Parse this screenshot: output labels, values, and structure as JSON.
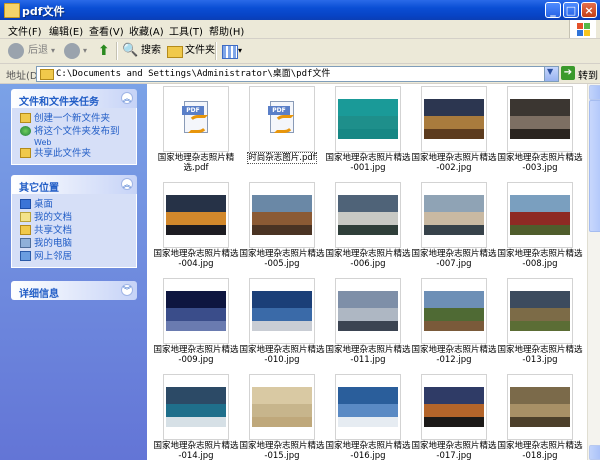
{
  "window": {
    "title": "pdf文件",
    "buttons": {
      "minimize": "_",
      "maximize": "□",
      "close": "×"
    }
  },
  "menu": [
    "文件(F)",
    "编辑(E)",
    "查看(V)",
    "收藏(A)",
    "工具(T)",
    "帮助(H)"
  ],
  "toolbar": {
    "back_label": "后退",
    "search_label": "搜索",
    "folders_label": "文件夹"
  },
  "address": {
    "label": "地址(D)",
    "path": "C:\\Documents and Settings\\Administrator\\桌面\\pdf文件",
    "go_label": "转到"
  },
  "sidebar": {
    "tasks": {
      "title": "文件和文件夹任务",
      "items": [
        "创建一个新文件夹",
        "将这个文件夹发布到",
        "Web",
        "共享此文件夹"
      ]
    },
    "places": {
      "title": "其它位置",
      "items": [
        "桌面",
        "我的文档",
        "共享文档",
        "我的电脑",
        "网上邻居"
      ]
    },
    "details": {
      "title": "详细信息"
    }
  },
  "files": [
    {
      "line1": "国家地理杂志照片精",
      "line2": "选.pdf",
      "kind": "pdf",
      "selected": false
    },
    {
      "line1": "时尚杂志图片.pdf",
      "line2": "",
      "kind": "pdf",
      "selected": true
    },
    {
      "line1": "国家地理杂志照片精选",
      "line2": "-001.jpg",
      "kind": "photo",
      "colors": [
        "#1a9a98",
        "#1e8f8b",
        "#168784"
      ]
    },
    {
      "line1": "国家地理杂志照片精选",
      "line2": "-002.jpg",
      "kind": "photo",
      "colors": [
        "#2c3650",
        "#a97b3d",
        "#5c3b1e"
      ]
    },
    {
      "line1": "国家地理杂志照片精选",
      "line2": "-003.jpg",
      "kind": "photo",
      "colors": [
        "#3b3631",
        "#7d6f63",
        "#2a241f"
      ]
    },
    {
      "line1": "国家地理杂志照片精选",
      "line2": "-004.jpg",
      "kind": "photo",
      "colors": [
        "#263247",
        "#d2882b",
        "#1d1c22"
      ]
    },
    {
      "line1": "国家地理杂志照片精选",
      "line2": "-005.jpg",
      "kind": "photo",
      "colors": [
        "#6a88a6",
        "#8b5a34",
        "#4a3323"
      ]
    },
    {
      "line1": "国家地理杂志照片精选",
      "line2": "-006.jpg",
      "kind": "photo",
      "colors": [
        "#4f6378",
        "#c8c9c4",
        "#2f3f3a"
      ]
    },
    {
      "line1": "国家地理杂志照片精选",
      "line2": "-007.jpg",
      "kind": "photo",
      "colors": [
        "#8fa3b5",
        "#c9b9a2",
        "#37424a"
      ]
    },
    {
      "line1": "国家地理杂志照片精选",
      "line2": "-008.jpg",
      "kind": "photo",
      "colors": [
        "#7a9fbf",
        "#8e2a24",
        "#4f5d2c"
      ]
    },
    {
      "line1": "国家地理杂志照片精选",
      "line2": "-009.jpg",
      "kind": "photo",
      "colors": [
        "#0e1640",
        "#3a4d8a",
        "#6a7bb0"
      ]
    },
    {
      "line1": "国家地理杂志照片精选",
      "line2": "-010.jpg",
      "kind": "photo",
      "colors": [
        "#1b3f78",
        "#3a6aa8",
        "#c9cdd4"
      ]
    },
    {
      "line1": "国家地理杂志照片精选",
      "line2": "-011.jpg",
      "kind": "photo",
      "colors": [
        "#7e8fa8",
        "#aeb7c3",
        "#3b4452"
      ]
    },
    {
      "line1": "国家地理杂志照片精选",
      "line2": "-012.jpg",
      "kind": "photo",
      "colors": [
        "#6d8fb6",
        "#4f6a34",
        "#7a5a3a"
      ]
    },
    {
      "line1": "国家地理杂志照片精选",
      "line2": "-013.jpg",
      "kind": "photo",
      "colors": [
        "#3c4b5e",
        "#7c6b47",
        "#5b6d35"
      ]
    },
    {
      "line1": "国家地理杂志照片精选",
      "line2": "-014.jpg",
      "kind": "photo",
      "colors": [
        "#2c4a66",
        "#1f6f8b",
        "#d6e0e6"
      ]
    },
    {
      "line1": "国家地理杂志照片精选",
      "line2": "-015.jpg",
      "kind": "photo",
      "colors": [
        "#d9c9a3",
        "#c7b58c",
        "#bfa87b"
      ]
    },
    {
      "line1": "国家地理杂志照片精选",
      "line2": "-016.jpg",
      "kind": "photo",
      "colors": [
        "#2a5e9b",
        "#5a8ac4",
        "#e6ecf2"
      ]
    },
    {
      "line1": "国家地理杂志照片精选",
      "line2": "-017.jpg",
      "kind": "photo",
      "colors": [
        "#2f3b66",
        "#b4652a",
        "#1c1a18"
      ]
    },
    {
      "line1": "国家地理杂志照片精选",
      "line2": "-018.jpg",
      "kind": "photo",
      "colors": [
        "#7b6a4a",
        "#a89066",
        "#4d402b"
      ]
    }
  ]
}
